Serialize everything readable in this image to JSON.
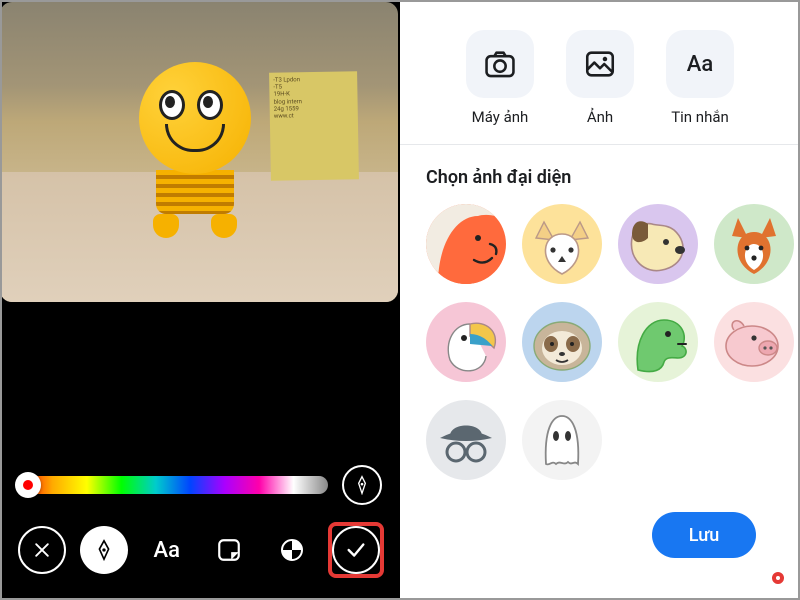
{
  "left": {
    "toolbar": {
      "close": "×",
      "pen": "✎",
      "text": "Aa",
      "sticker": "❐",
      "mask": "⬚",
      "confirm": "✓"
    }
  },
  "right": {
    "sources": {
      "camera": "Máy ảnh",
      "gallery": "Ảnh",
      "message": "Tin nhắn",
      "message_glyph": "Aa"
    },
    "section_title": "Chọn ảnh đại diện",
    "avatars": [
      {
        "name": "orange-face",
        "bg": "#ff6a3d"
      },
      {
        "name": "yellow-fox",
        "bg": "#fde29a"
      },
      {
        "name": "purple-dog",
        "bg": "#d9c6ee"
      },
      {
        "name": "green-fox",
        "bg": "#cfe8c9"
      },
      {
        "name": "pink-toucan",
        "bg": "#f6c6d6"
      },
      {
        "name": "blue-sloth",
        "bg": "#bcd5ee"
      },
      {
        "name": "green-dino",
        "bg": "#e6f3d8"
      },
      {
        "name": "pink-pig",
        "bg": "#fbe0e1"
      },
      {
        "name": "gray-incognito",
        "bg": "#e6e8eb"
      },
      {
        "name": "ghost",
        "bg": "#f3f3f3"
      }
    ],
    "save_label": "Lưu"
  }
}
